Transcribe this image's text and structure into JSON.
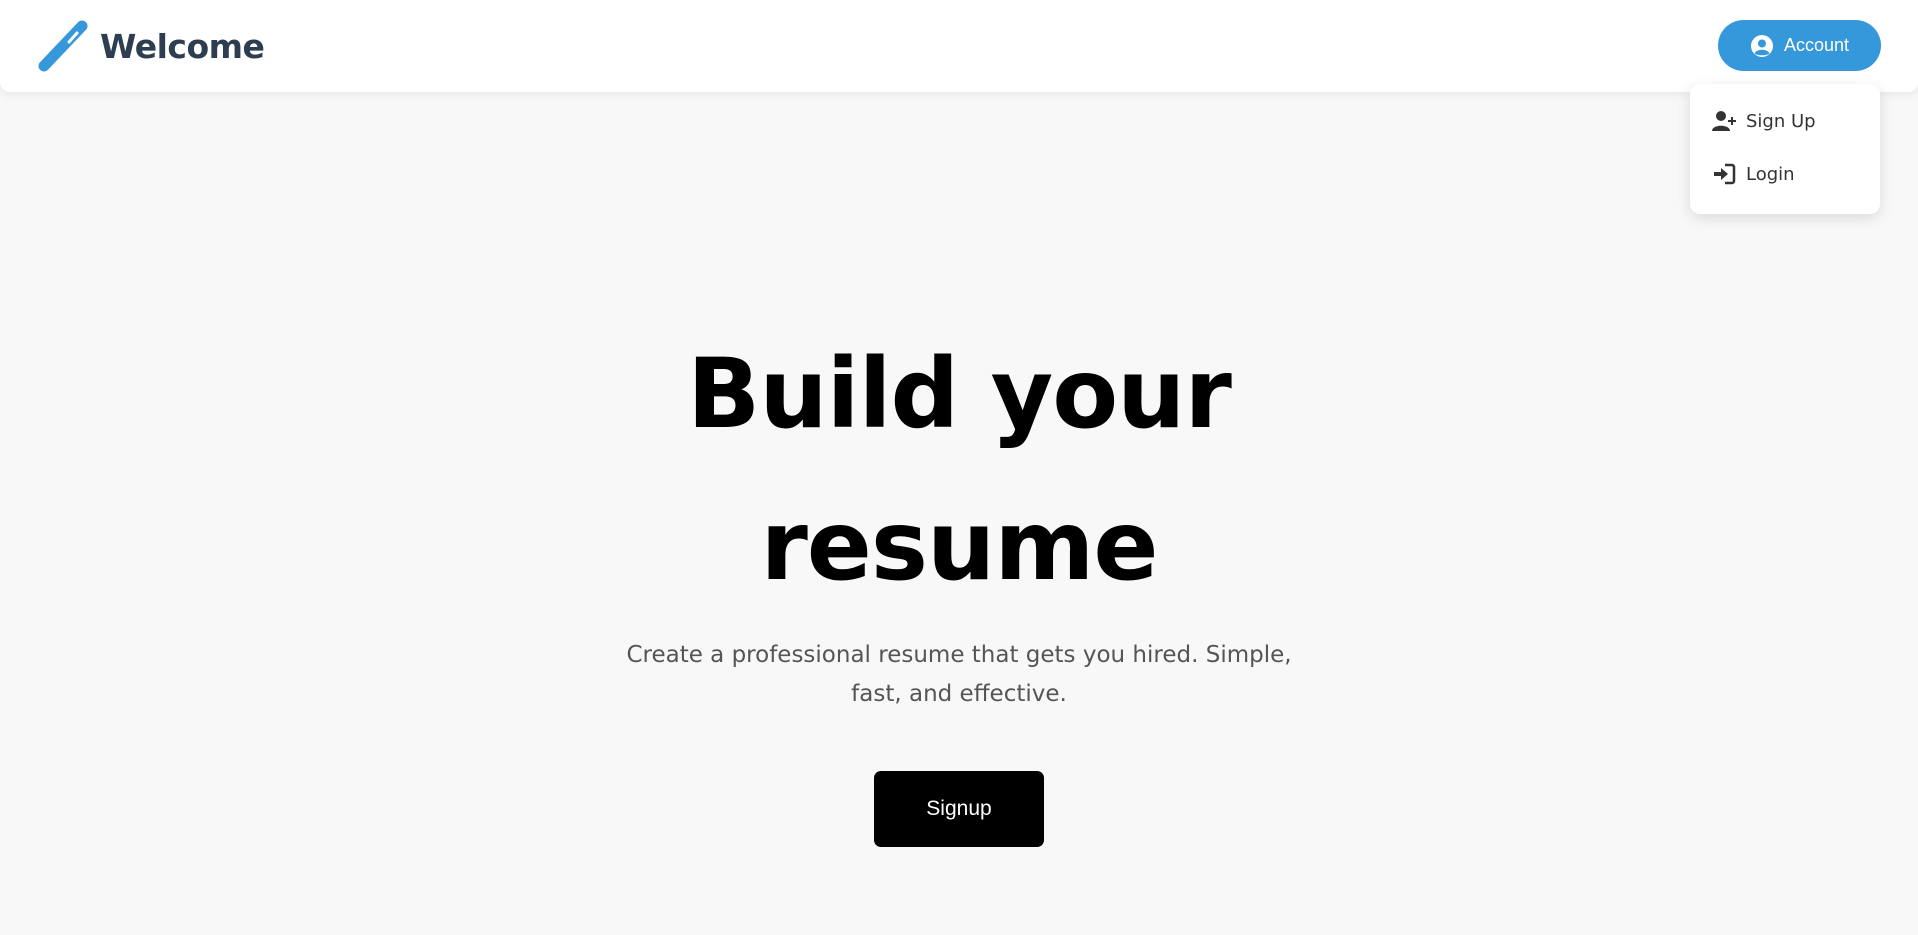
{
  "header": {
    "brand_title": "Welcome",
    "brand_icon": "pencil-icon",
    "account_label": "Account",
    "account_icon": "user-circle-icon"
  },
  "account_menu": {
    "items": [
      {
        "label": "Sign Up",
        "icon": "user-plus-icon"
      },
      {
        "label": "Login",
        "icon": "sign-in-icon"
      }
    ]
  },
  "hero": {
    "title_line1": "Build your",
    "title_line2": "resume",
    "subtitle": "Create a professional resume that gets you hired. Simple, fast, and effective.",
    "cta_label": "Signup"
  },
  "colors": {
    "accent": "#3498db",
    "brand_text": "#2c3e50",
    "background": "#f8f8f8",
    "cta": "#000000"
  }
}
